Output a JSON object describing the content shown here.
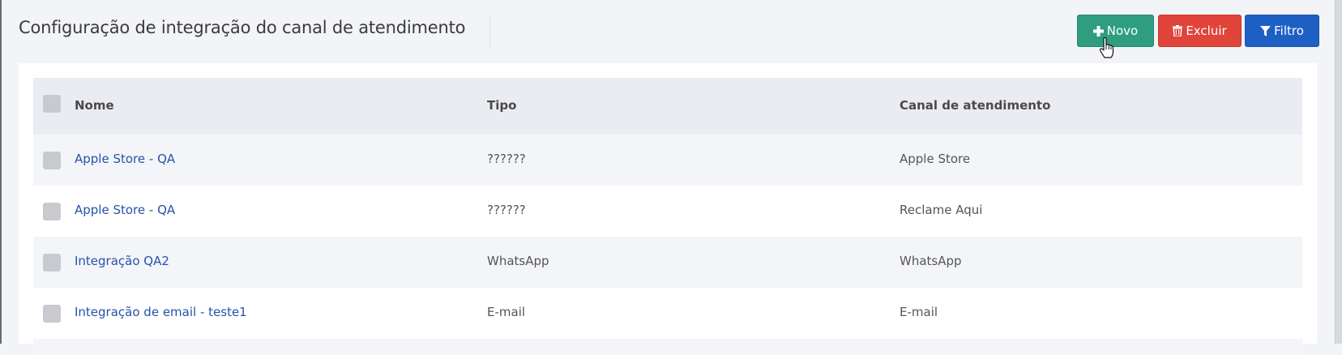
{
  "page": {
    "title": "Configuração de integração do canal de atendimento"
  },
  "toolbar": {
    "novo_label": "Novo",
    "excluir_label": "Excluir",
    "filtro_label": "Filtro",
    "novo_icon": "plus-icon",
    "excluir_icon": "trash-icon",
    "filtro_icon": "filter-icon",
    "colors": {
      "novo": "#2e9e7f",
      "excluir": "#e0443a",
      "filtro": "#1e5fc4"
    }
  },
  "table": {
    "columns": [
      "Nome",
      "Tipo",
      "Canal de atendimento"
    ],
    "rows": [
      {
        "nome": "Apple Store - QA",
        "tipo": "??????",
        "canal": "Apple Store"
      },
      {
        "nome": "Apple Store - QA",
        "tipo": "??????",
        "canal": "Reclame Aqui"
      },
      {
        "nome": "Integração QA2",
        "tipo": "WhatsApp",
        "canal": "WhatsApp"
      },
      {
        "nome": "Integração de email - teste1",
        "tipo": "E-mail",
        "canal": "E-mail"
      }
    ]
  }
}
